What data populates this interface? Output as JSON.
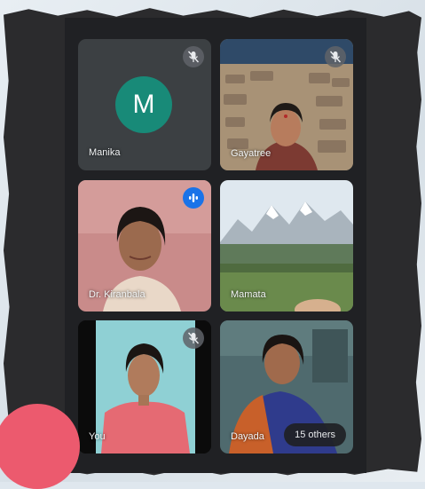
{
  "participants": [
    {
      "name": "Manika",
      "initial": "M",
      "muted": true,
      "icon": "mic-off-icon"
    },
    {
      "name": "Gayatree",
      "muted": true,
      "icon": "mic-off-icon"
    },
    {
      "name": "Dr. Kiranbala",
      "speaking": true,
      "icon": "audio-level-icon"
    },
    {
      "name": "Mamata"
    },
    {
      "name": "You",
      "muted": true,
      "icon": "mic-off-icon"
    },
    {
      "name": "Dayada"
    }
  ],
  "others_label": "15 others",
  "colors": {
    "background": "#202124",
    "tile": "#3c4043",
    "avatar": "#188a78",
    "speaking": "#1a73e8",
    "corner_button": "#ec5a6e"
  }
}
